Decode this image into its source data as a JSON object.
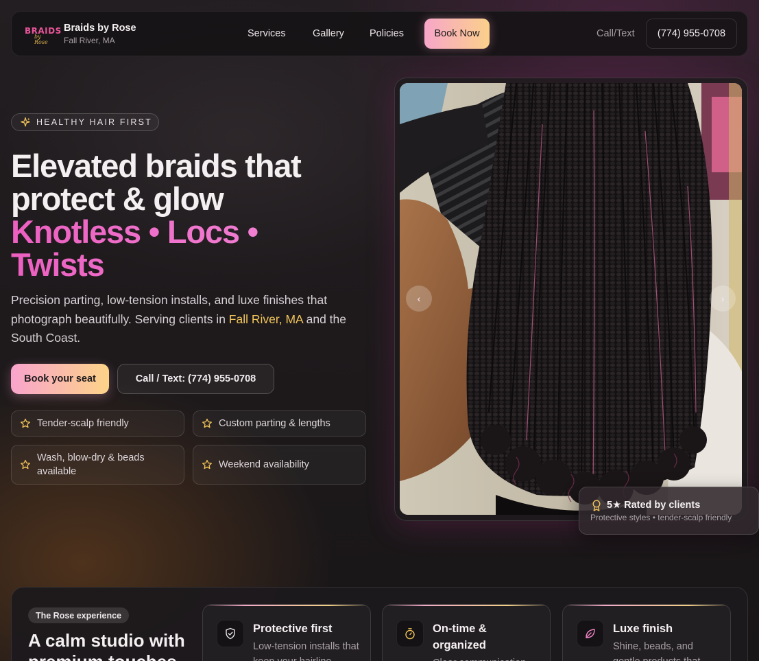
{
  "nav": {
    "logo_top": "BRAIDS",
    "logo_script": "by Rose",
    "brand_name": "Braids by Rose",
    "brand_location": "Fall River, MA",
    "links": [
      "Services",
      "Gallery",
      "Policies"
    ],
    "book_label": "Book Now",
    "call_label": "Call/Text",
    "phone": "(774) 955-0708"
  },
  "hero": {
    "badge": "HEALTHY HAIR FIRST",
    "headline_1": "Elevated braids that",
    "headline_2": "protect & glow",
    "headline_3": "Knotless • Locs •",
    "headline_4": "Twists",
    "lede_before": "Precision parting, low-tension installs, and luxe finishes that photograph beautifully. Serving clients in ",
    "lede_highlight": "Fall River, MA",
    "lede_after": " and the South Coast.",
    "cta_primary": "Book your seat",
    "cta_secondary": "Call / Text: (774) 955-0708",
    "features": [
      "Tender-scalp friendly",
      "Custom parting & lengths",
      "Wash, blow-dry & beads available",
      "Weekend availability"
    ]
  },
  "gallery": {
    "prev_label": "‹",
    "next_label": "›"
  },
  "rating": {
    "title": "5★ Rated by clients",
    "subtitle": "Protective styles • tender-scalp friendly"
  },
  "experience": {
    "tag": "The Rose experience",
    "heading": "A calm studio with premium touches",
    "cards": [
      {
        "title": "Protective first",
        "desc": "Low-tension installs that keep your hairline"
      },
      {
        "title": "On-time & organized",
        "desc": "Clear communication"
      },
      {
        "title": "Luxe finish",
        "desc": "Shine, beads, and gentle products that"
      }
    ]
  },
  "colors": {
    "accent_pink": "#ec5fc0",
    "accent_gold": "#f3c65a",
    "button_gradient_start": "#f7a6c9",
    "button_gradient_end": "#fbd08a"
  }
}
